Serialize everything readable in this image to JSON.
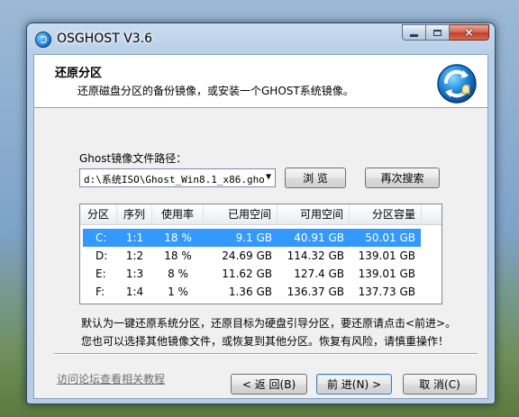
{
  "window": {
    "title": "OSGHOST V3.6",
    "caption_close": "×"
  },
  "header": {
    "title": "还原分区",
    "subtitle": "还原磁盘分区的备份镜像，或安装一个GHOST系统镜像。"
  },
  "image_path": {
    "label": "Ghost镜像文件路径：",
    "value": "d:\\系统ISO\\Ghost_Win8.1_x86.gho",
    "dropdown_arrow": "▼",
    "browse_label": "浏 览",
    "search_label": "再次搜索"
  },
  "partitions": {
    "columns": [
      "分区",
      "序列",
      "使用率",
      "已用空间",
      "可用空间",
      "分区容量"
    ],
    "rows": [
      [
        "C:",
        "1:1",
        "18 %",
        "9.1 GB",
        "40.91 GB",
        "50.01 GB"
      ],
      [
        "D:",
        "1:2",
        "18 %",
        "24.69 GB",
        "114.32 GB",
        "139.01 GB"
      ],
      [
        "E:",
        "1:3",
        "8 %",
        "11.62 GB",
        "127.4 GB",
        "139.01 GB"
      ],
      [
        "F:",
        "1:4",
        "1 %",
        "1.36 GB",
        "136.37 GB",
        "137.73 GB"
      ]
    ],
    "selected_index": 0
  },
  "notes": {
    "line1": "默认为一键还原系统分区，还原目标为硬盘引导分区，要还原请点击<前进>。",
    "line2": "您也可以选择其他镜像文件，或恢复到其他分区。恢复有风险，请慎重操作！"
  },
  "footer": {
    "help_link": "访问论坛查看相关教程",
    "back_label": "< 返 回(B)",
    "next_label": "前 进(N) >",
    "cancel_label": "取 消(C)"
  },
  "colors": {
    "selection": "#3399ff",
    "link": "#6f6f6f"
  }
}
